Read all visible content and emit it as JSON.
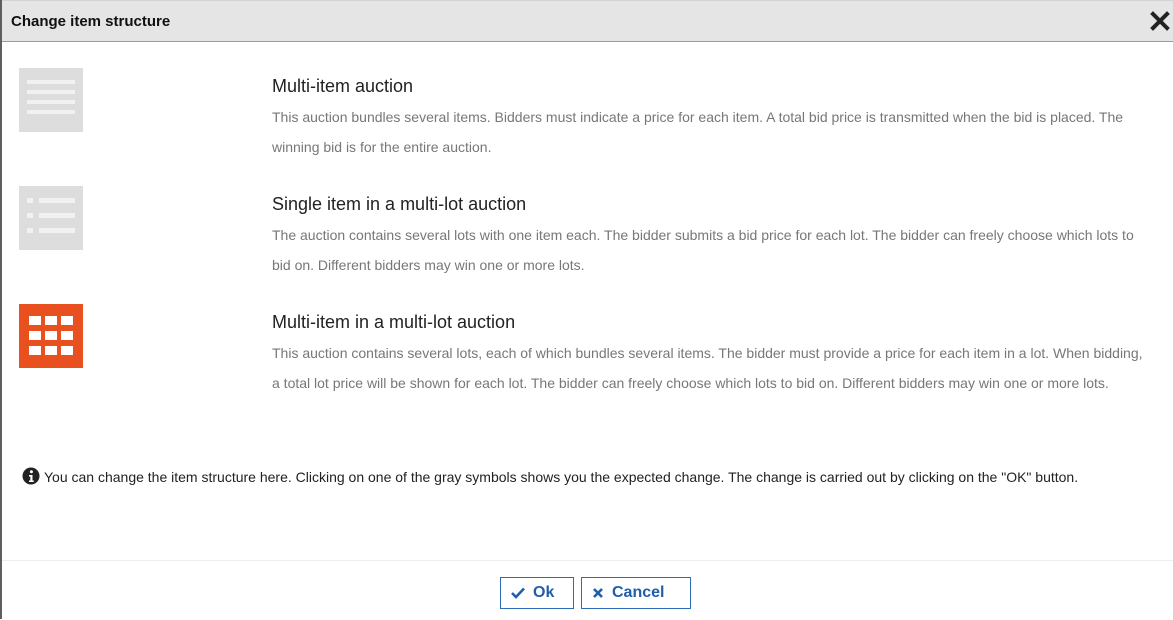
{
  "dialog": {
    "title": "Change item structure"
  },
  "options": [
    {
      "title": "Multi-item auction",
      "description": "This auction bundles several items. Bidders must indicate a price for each item. A total bid price is transmitted when the bid is placed. The winning bid is for the entire auction.",
      "icon": "lines-icon",
      "selected": false
    },
    {
      "title": "Single item in a multi-lot auction",
      "description": "The auction contains several lots with one item each. The bidder submits a bid price for each lot. The bidder can freely choose which lots to bid on. Different bidders may win one or more lots.",
      "icon": "list-icon",
      "selected": false
    },
    {
      "title": "Multi-item in a multi-lot auction",
      "description": "This auction contains several lots, each of which bundles several items. The bidder must provide a price for each item in a lot. When bidding, a total lot price will be shown for each lot. The bidder can freely choose which lots to bid on. Different bidders may win one or more lots.",
      "icon": "grid-icon",
      "selected": true
    }
  ],
  "info": {
    "text": "You can change the item structure here. Clicking on one of the gray symbols shows you the expected change. The change is carried out by clicking on the \"OK\" button."
  },
  "buttons": {
    "ok_label": "Ok",
    "cancel_label": "Cancel"
  },
  "colors": {
    "accent": "#e8501f",
    "inactive_icon": "#dddddd",
    "button_text": "#1f5fa8",
    "titlebar": "#e5e5e5"
  }
}
